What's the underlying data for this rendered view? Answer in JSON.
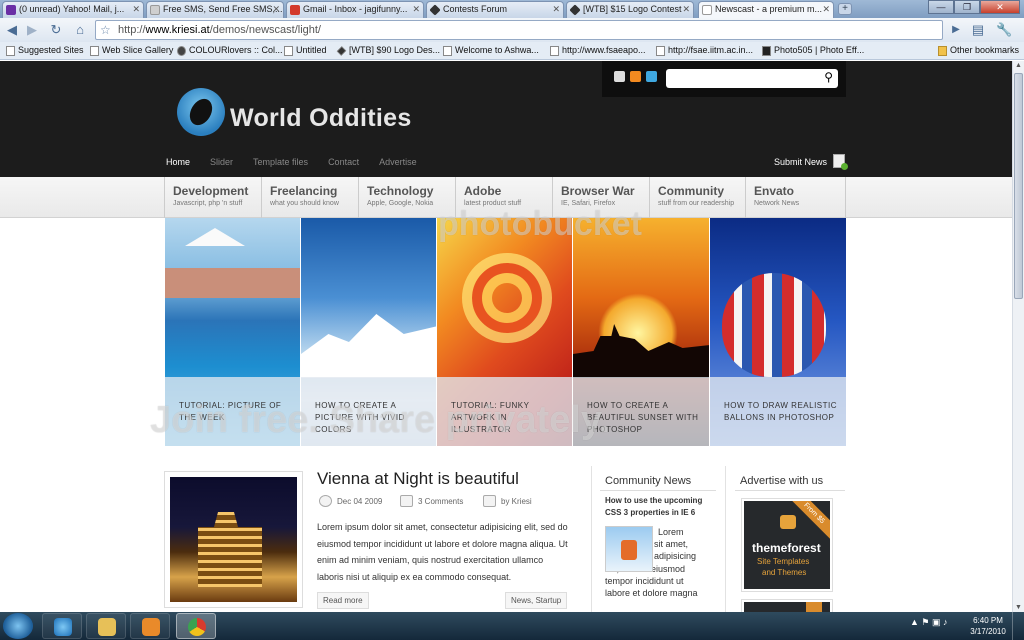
{
  "browser": {
    "tabs": [
      {
        "title": "(0 unread) Yahoo! Mail, j...",
        "color": "#6b2fa5"
      },
      {
        "title": "Free SMS, Send Free SMS,...",
        "color": "#cfcfcf"
      },
      {
        "title": "Gmail - Inbox - jagifunny...",
        "color": "#d33a2c"
      },
      {
        "title": "Contests Forum",
        "color": "#333333"
      },
      {
        "title": "[WTB] $15 Logo Contest",
        "color": "#333333"
      },
      {
        "title": "Newscast - a premium m...",
        "color": "#cfcfcf"
      }
    ],
    "new_tab": "+",
    "url_prefix": "http://",
    "url_domain": "www.kriesi.at",
    "url_path": "/demos/newscast/light/",
    "bookmarks": [
      "Suggested Sites",
      "Web Slice Gallery",
      "COLOURlovers :: Col...",
      "Untitled",
      "[WTB] $90 Logo Des...",
      "Welcome to Ashwa...",
      "http://www.fsaeapo...",
      "http://fsae.iitm.ac.in...",
      "Photo505 | Photo Eff...",
      "Other bookmarks"
    ]
  },
  "site": {
    "logo_text": "World Oddities",
    "top_nav": [
      "Home",
      "Slider",
      "Template files",
      "Contact",
      "Advertise"
    ],
    "submit_news": "Submit News",
    "categories": [
      {
        "title": "Development",
        "sub": "Javascript, php 'n stuff"
      },
      {
        "title": "Freelancing",
        "sub": "what you should know"
      },
      {
        "title": "Technology",
        "sub": "Apple, Google, Nokia"
      },
      {
        "title": "Adobe",
        "sub": "latest product stuff"
      },
      {
        "title": "Browser War",
        "sub": "IE, Safari, Firefox"
      },
      {
        "title": "Community",
        "sub": "stuff from our readership"
      },
      {
        "title": "Envato",
        "sub": "Network News"
      }
    ],
    "slides": [
      "TUTORIAL: PICTURE OF THE WEEK",
      "HOW TO CREATE A PICTURE WITH VIVID COLORS",
      "TUTORIAL: FUNKY ARTWORK IN ILLUSTRATOR",
      "HOW TO CREATE A BEAUTIFUL SUNSET WITH PHOTOSHOP",
      "HOW TO DRAW REALISTIC BALLONS IN PHOTOSHOP"
    ],
    "post": {
      "title": "Vienna at Night is beautiful",
      "date": "Dec 04 2009",
      "comments": "3 Comments",
      "author": "by Kriesi",
      "excerpt": "Lorem ipsum dolor sit amet, consectetur adipisicing elit, sed do eiusmod tempor incididunt ut labore et dolore magna aliqua. Ut enim ad minim veniam, quis nostrud exercitation ullamco laboris nisi ut aliquip ex ea commodo consequat.",
      "read_more": "Read more",
      "tags": "News, Startup"
    },
    "community": {
      "title": "Community News",
      "link": "How to use the upcoming CSS 3 properties in IE 6",
      "text": "Lorem ipsum dolor sit amet, consectetur adipisicing elit, sed do eiusmod tempor incididunt ut labore et dolore magna"
    },
    "advertise": {
      "title": "Advertise with us",
      "badge": "From $5",
      "brand": "themeforest",
      "line1": "Site Templates",
      "line2": "and Themes"
    }
  },
  "watermark": {
    "top": "photobucket",
    "bottom": "Join free. Share privately."
  },
  "taskbar": {
    "time": "6:40 PM",
    "date": "3/17/2010"
  }
}
